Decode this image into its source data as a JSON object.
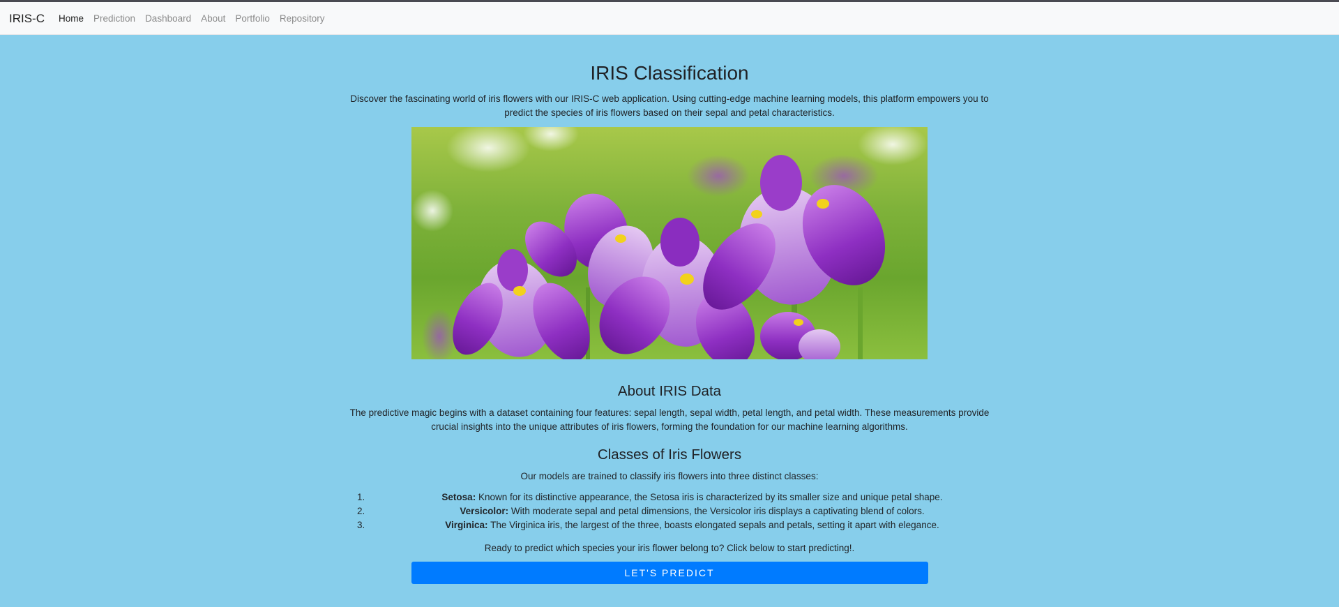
{
  "nav": {
    "brand": "IRIS-C",
    "items": [
      {
        "label": "Home",
        "active": true
      },
      {
        "label": "Prediction",
        "active": false
      },
      {
        "label": "Dashboard",
        "active": false
      },
      {
        "label": "About",
        "active": false
      },
      {
        "label": "Portfolio",
        "active": false
      },
      {
        "label": "Repository",
        "active": false
      }
    ]
  },
  "main": {
    "title": "IRIS Classification",
    "intro": "Discover the fascinating world of iris flowers with our IRIS-C web application. Using cutting-edge machine learning models, this platform empowers you to predict the species of iris flowers based on their sepal and petal characteristics.",
    "about_title": "About IRIS Data",
    "about_text": "The predictive magic begins with a dataset containing four features: sepal length, sepal width, petal length, and petal width. These measurements provide crucial insights into the unique attributes of iris flowers, forming the foundation for our machine learning algorithms.",
    "classes_title": "Classes of Iris Flowers",
    "classes_intro": "Our models are trained to classify iris flowers into three distinct classes:",
    "classes": [
      {
        "num": "1.",
        "name": "Setosa:",
        "desc": " Known for its distinctive appearance, the Setosa iris is characterized by its smaller size and unique petal shape."
      },
      {
        "num": "2.",
        "name": "Versicolor:",
        "desc": " With moderate sepal and petal dimensions, the Versicolor iris displays a captivating blend of colors."
      },
      {
        "num": "3.",
        "name": "Virginica:",
        "desc": " The Virginica iris, the largest of the three, boasts elongated sepals and petals, setting it apart with elegance."
      }
    ],
    "ready_text": "Ready to predict which species your iris flower belong to? Click below to start predicting!.",
    "predict_button": "LET'S PREDICT"
  },
  "colors": {
    "page_bg": "#87ceeb",
    "navbar_bg": "#f8f9fa",
    "button_bg": "#007bff"
  }
}
